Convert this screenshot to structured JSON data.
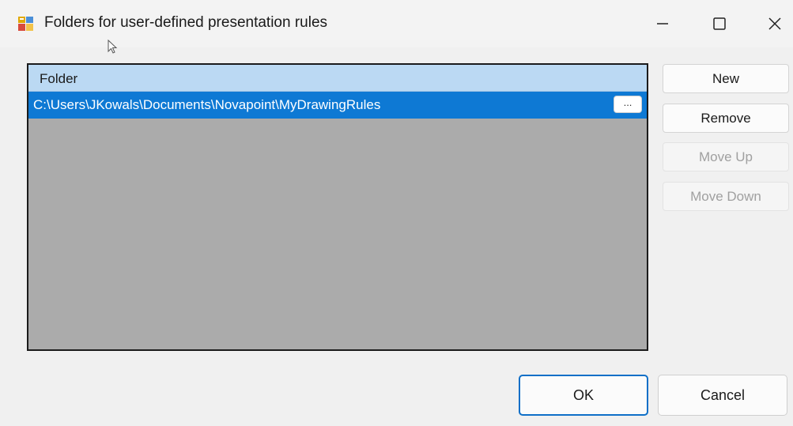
{
  "window": {
    "title": "Folders for user-defined presentation rules",
    "icon": "app-icon",
    "controls": {
      "minimize": "minimize-icon",
      "maximize": "maximize-icon",
      "close": "close-icon"
    }
  },
  "grid": {
    "column_header": "Folder",
    "rows": [
      {
        "path": "C:\\Users\\JKowals\\Documents\\Novapoint\\MyDrawingRules",
        "browse_label": "...",
        "selected": true
      }
    ]
  },
  "side_buttons": {
    "new": "New",
    "remove": "Remove",
    "move_up": "Move Up",
    "move_down": "Move Down"
  },
  "footer": {
    "ok": "OK",
    "cancel": "Cancel"
  },
  "colors": {
    "header_bg": "#bbd9f3",
    "selection": "#0e79d4",
    "grid_bg": "#ababab",
    "accent": "#0e6fc7"
  }
}
